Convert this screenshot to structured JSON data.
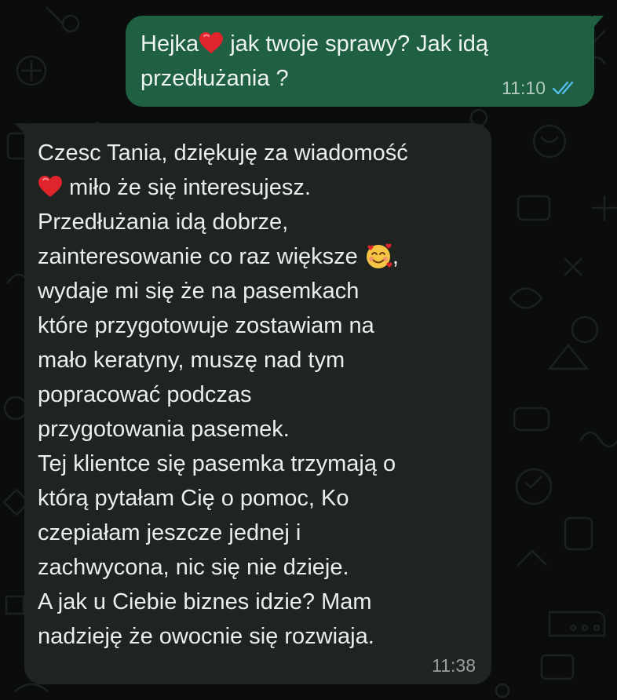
{
  "chat": {
    "outgoing": {
      "lines": [
        {
          "before": "Hejka",
          "emoji": "red-heart",
          "after": " jak twoje sprawy? Jak idą"
        },
        {
          "text": "przedłużania ?"
        }
      ],
      "time": "11:10",
      "status": "read-double-check-icon",
      "status_color": "#53bdeb"
    },
    "incoming": {
      "lines": [
        {
          "text": "Czesc Tania, dziękuję za wiadomość"
        },
        {
          "emoji": "red-heart",
          "after": " miło że się interesujesz."
        },
        {
          "text": "Przedłużania idą dobrze,"
        },
        {
          "before": "zainteresowanie co raz większe ",
          "emoji": "smiling-face-with-hearts",
          "after": ","
        },
        {
          "text": "wydaje mi się że na pasemkach"
        },
        {
          "text": "które przygotowuje zostawiam na"
        },
        {
          "text": "mało keratyny, muszę nad tym"
        },
        {
          "text": "popracować podczas"
        },
        {
          "text": "przygotowania pasemek."
        },
        {
          "text": "Tej klientce się pasemka trzymają o"
        },
        {
          "text": "którą pytałam Cię o pomoc, Ko"
        },
        {
          "text": "czepiałam jeszcze jednej i"
        },
        {
          "text": "zachwycona, nic się nie dzieje."
        },
        {
          "text": "A jak u Ciebie biznes idzie? Mam"
        },
        {
          "text": "nadzieję że owocnie się rozwiaja."
        }
      ],
      "time": "11:38"
    }
  },
  "colors": {
    "background": "#0b0d0c",
    "outgoing_bubble": "#1f5f42",
    "incoming_bubble": "#1f2421"
  }
}
